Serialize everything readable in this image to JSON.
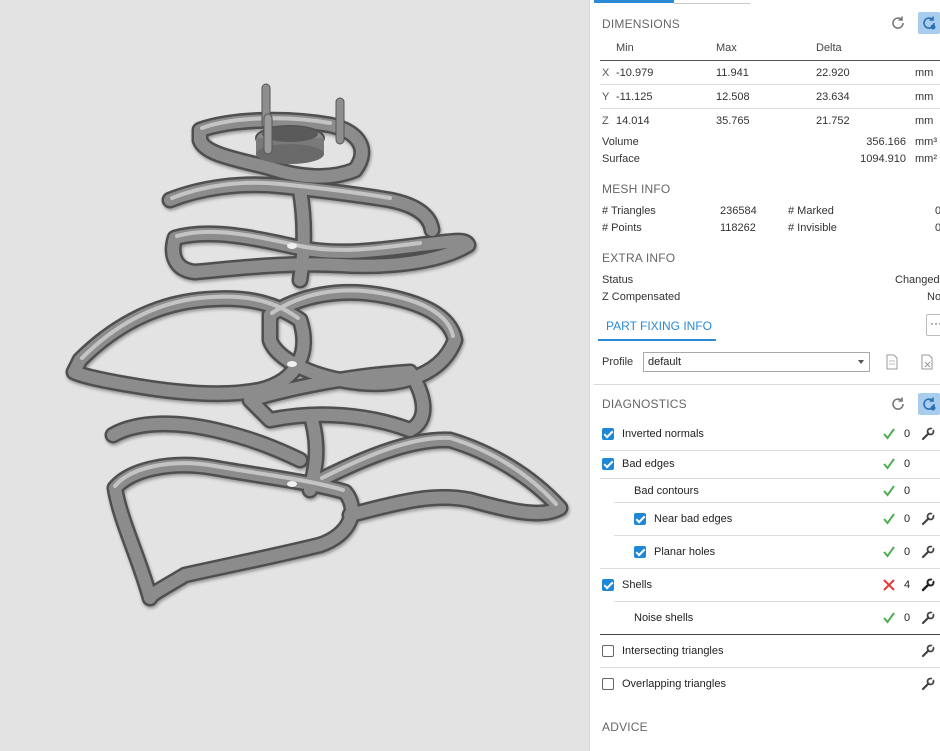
{
  "dimensions": {
    "title": "DIMENSIONS",
    "headers": {
      "min": "Min",
      "max": "Max",
      "delta": "Delta"
    },
    "rows": [
      {
        "axis": "X",
        "min": "-10.979",
        "max": "11.941",
        "delta": "22.920",
        "unit": "mm"
      },
      {
        "axis": "Y",
        "min": "-11.125",
        "max": "12.508",
        "delta": "23.634",
        "unit": "mm"
      },
      {
        "axis": "Z",
        "min": "14.014",
        "max": "35.765",
        "delta": "21.752",
        "unit": "mm"
      }
    ],
    "volume": {
      "label": "Volume",
      "value": "356.166",
      "unit": "mm³"
    },
    "surface": {
      "label": "Surface",
      "value": "1094.910",
      "unit": "mm²"
    }
  },
  "mesh_info": {
    "title": "MESH INFO",
    "triangles_label": "# Triangles",
    "triangles_value": "236584",
    "marked_label": "# Marked",
    "marked_value": "0",
    "points_label": "# Points",
    "points_value": "118262",
    "invisible_label": "# Invisible",
    "invisible_value": "0"
  },
  "extra_info": {
    "title": "EXTRA INFO",
    "status_label": "Status",
    "status_value": "Changed",
    "zcomp_label": "Z Compensated",
    "zcomp_value": "No"
  },
  "part_fixing": {
    "tab_label": "PART FIXING INFO",
    "more_label": "···",
    "profile_label": "Profile",
    "profile_value": "default"
  },
  "diagnostics": {
    "title": "DIAGNOSTICS",
    "rows": [
      {
        "label": "Inverted normals",
        "count": "0"
      },
      {
        "label": "Bad edges",
        "count": "0"
      },
      {
        "label": "Bad contours",
        "count": "0"
      },
      {
        "label": "Near bad edges",
        "count": "0"
      },
      {
        "label": "Planar holes",
        "count": "0"
      },
      {
        "label": "Shells",
        "count": "4"
      },
      {
        "label": "Noise shells",
        "count": "0"
      },
      {
        "label": "Intersecting triangles",
        "count": ""
      },
      {
        "label": "Overlapping triangles",
        "count": ""
      }
    ]
  },
  "advice": {
    "title": "ADVICE"
  },
  "colors": {
    "accent": "#2a8ad4",
    "ok": "#4caf50",
    "error": "#e53935",
    "viewport_bg": "#e3e3e3",
    "model": "#7a7a7a"
  },
  "icons": {
    "refresh": "refresh-icon",
    "auto_refresh": "auto-refresh-icon",
    "wrench": "wrench-icon",
    "check": "check-icon",
    "cross": "cross-icon"
  }
}
